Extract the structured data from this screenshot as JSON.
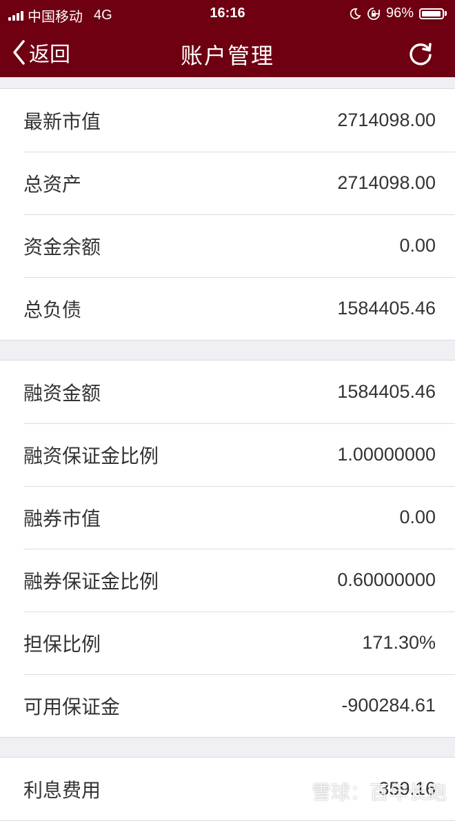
{
  "status_bar": {
    "carrier": "中国移动",
    "network": "4G",
    "time": "16:16",
    "battery": "96%",
    "battery_level": 0.96,
    "icons": [
      "signal-bars-icon",
      "moon-icon",
      "rotation-lock-icon",
      "battery-icon"
    ]
  },
  "nav": {
    "back_label": "返回",
    "title": "账户管理",
    "icons": [
      "chevron-left-icon",
      "refresh-icon"
    ]
  },
  "groups": [
    {
      "rows": [
        {
          "label": "最新市值",
          "value": "2714098.00"
        },
        {
          "label": "总资产",
          "value": "2714098.00"
        },
        {
          "label": "资金余额",
          "value": "0.00"
        },
        {
          "label": "总负债",
          "value": "1584405.46"
        }
      ]
    },
    {
      "rows": [
        {
          "label": "融资金额",
          "value": "1584405.46"
        },
        {
          "label": "融资保证金比例",
          "value": "1.00000000"
        },
        {
          "label": "融券市值",
          "value": "0.00"
        },
        {
          "label": "融券保证金比例",
          "value": "0.60000000"
        },
        {
          "label": "担保比例",
          "value": "171.30%"
        },
        {
          "label": "可用保证金",
          "value": "-900284.61"
        }
      ]
    },
    {
      "rows": [
        {
          "label": "利息费用",
          "value": "359.16"
        }
      ]
    }
  ],
  "watermark": {
    "text": "雪球：百年长跑",
    "icon": "snowball-logo-icon"
  },
  "colors": {
    "header_bg": "#6e0012",
    "page_bg": "#efeff4",
    "row_bg": "#ffffff",
    "text": "#333333"
  }
}
